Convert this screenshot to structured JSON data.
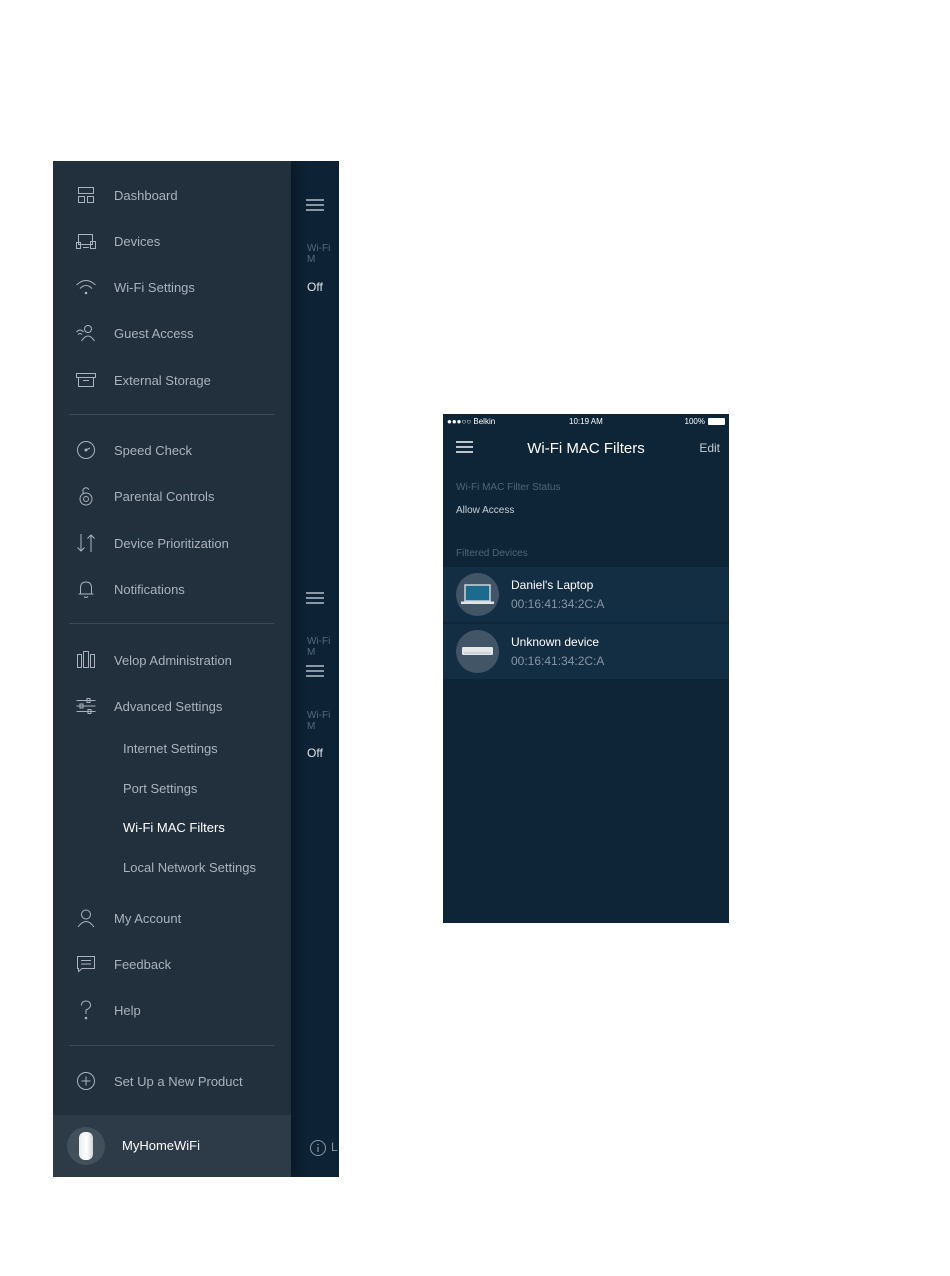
{
  "sidebar": {
    "items": [
      {
        "label": "Dashboard",
        "icon": "dashboard-icon"
      },
      {
        "label": "Devices",
        "icon": "devices-icon"
      },
      {
        "label": "Wi-Fi Settings",
        "icon": "wifi-icon"
      },
      {
        "label": "Guest Access",
        "icon": "guest-access-icon"
      },
      {
        "label": "External Storage",
        "icon": "external-storage-icon"
      },
      {
        "label": "Speed Check",
        "icon": "speed-check-icon"
      },
      {
        "label": "Parental Controls",
        "icon": "parental-controls-icon"
      },
      {
        "label": "Device Prioritization",
        "icon": "device-prioritization-icon"
      },
      {
        "label": "Notifications",
        "icon": "bell-icon"
      },
      {
        "label": "Velop Administration",
        "icon": "velop-administration-icon"
      },
      {
        "label": "Advanced Settings",
        "icon": "sliders-icon"
      },
      {
        "label": "My Account",
        "icon": "user-icon"
      },
      {
        "label": "Feedback",
        "icon": "feedback-icon"
      },
      {
        "label": "Help",
        "icon": "help-icon"
      },
      {
        "label": "Set Up a New Product",
        "icon": "plus-circle-icon"
      }
    ],
    "subitems": [
      {
        "label": "Internet Settings"
      },
      {
        "label": "Port Settings"
      },
      {
        "label": "Wi-Fi MAC Filters",
        "active": true
      },
      {
        "label": "Local Network Settings"
      }
    ],
    "network_name": "MyHomeWiFi"
  },
  "background_app": {
    "off_label_1": "Off",
    "off_label_2": "Off"
  },
  "phone": {
    "status_bar": {
      "carrier": "●●●○○ Belkin",
      "time": "10:19 AM",
      "battery": "100%"
    },
    "title": "Wi-Fi MAC Filters",
    "edit_label": "Edit",
    "filter_status_label": "Wi-Fi MAC Filter Status",
    "filter_status_value": "Allow Access",
    "filtered_devices_label": "Filtered Devices",
    "devices": [
      {
        "name": "Daniel's Laptop",
        "mac": "00:16:41:34:2C:A",
        "icon": "laptop-icon"
      },
      {
        "name": "Unknown device",
        "mac": "00:16:41:34:2C:A",
        "icon": "unknown-device-icon"
      }
    ]
  },
  "colors": {
    "menu_bg": "#22303d",
    "app_bg": "#0e2538",
    "row_bg": "#132d43",
    "text_muted": "#aab3bd"
  }
}
